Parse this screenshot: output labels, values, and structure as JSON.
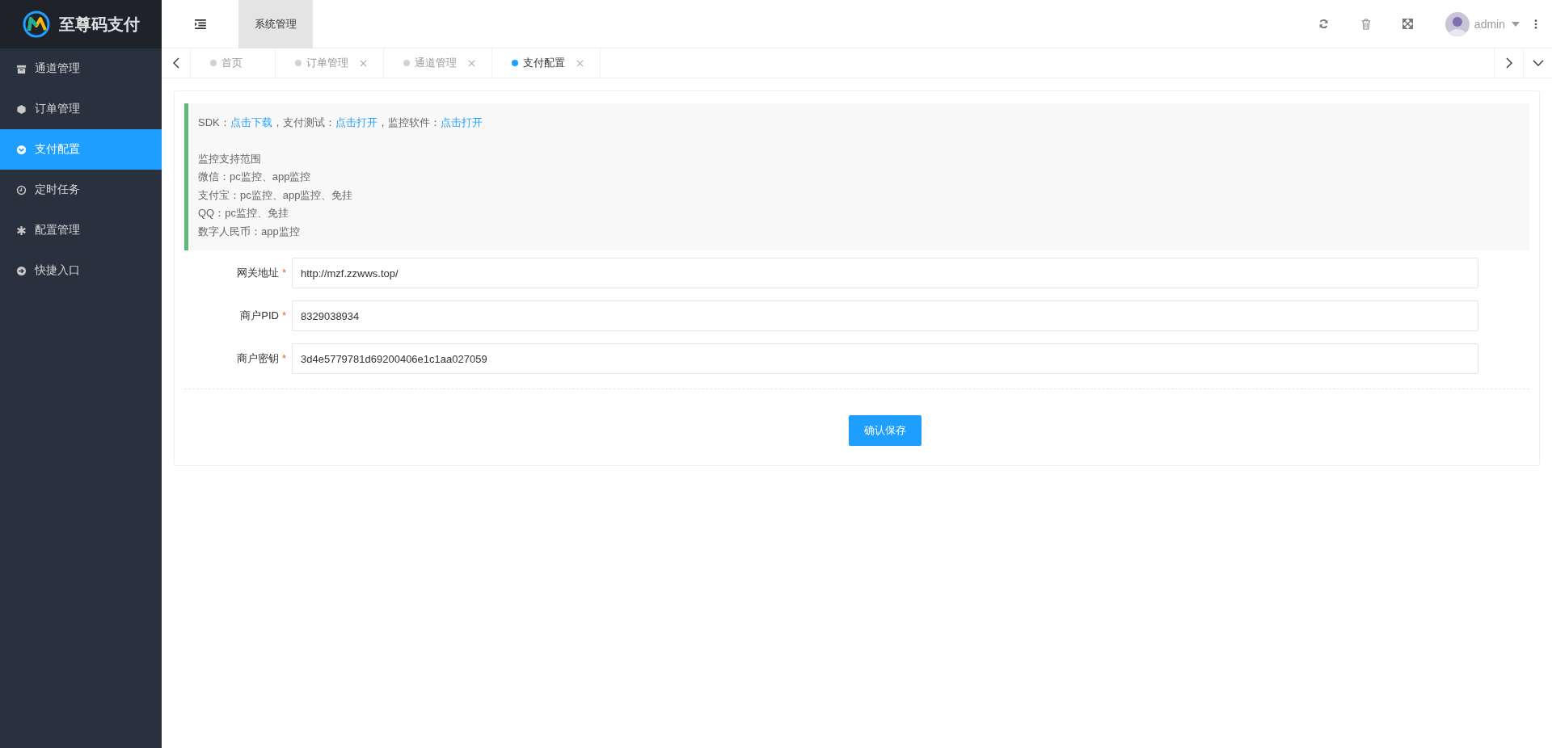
{
  "brand": {
    "title": "至尊码支付"
  },
  "header": {
    "nav_tabs": [
      {
        "label": "系统管理",
        "selected": true
      }
    ],
    "user": {
      "name": "admin"
    }
  },
  "sidebar": {
    "items": [
      {
        "label": "通道管理",
        "selected": false
      },
      {
        "label": "订单管理",
        "selected": false
      },
      {
        "label": "支付配置",
        "selected": true
      },
      {
        "label": "定时任务",
        "selected": false
      },
      {
        "label": "配置管理",
        "selected": false
      },
      {
        "label": "快捷入口",
        "selected": false
      }
    ]
  },
  "tabs": [
    {
      "label": "首页",
      "selected": false,
      "closable": false
    },
    {
      "label": "订单管理",
      "selected": false,
      "closable": true
    },
    {
      "label": "通道管理",
      "selected": false,
      "closable": true
    },
    {
      "label": "支付配置",
      "selected": true,
      "closable": true
    }
  ],
  "notice": {
    "links_line": [
      {
        "kind": "text",
        "text": "SDK："
      },
      {
        "kind": "link",
        "text": "点击下载"
      },
      {
        "kind": "text",
        "text": "，支付测试："
      },
      {
        "kind": "link",
        "text": "点击打开"
      },
      {
        "kind": "text",
        "text": "，监控软件："
      },
      {
        "kind": "link",
        "text": "点击打开"
      }
    ],
    "lines": [
      "监控支持范围",
      "微信：pc监控、app监控",
      "支付宝：pc监控、app监控、免挂",
      "QQ：pc监控、免挂",
      "数字人民币：app监控"
    ]
  },
  "form": {
    "fields": [
      {
        "label": "网关地址",
        "required_mark": "*",
        "value": "http://mzf.zzwws.top/"
      },
      {
        "label": "商户PID",
        "required_mark": "*",
        "value": "8329038934"
      },
      {
        "label": "商户密钥",
        "required_mark": "*",
        "value": "3d4e5779781d69200406e1c1aa027059"
      }
    ],
    "submit": "确认保存"
  }
}
